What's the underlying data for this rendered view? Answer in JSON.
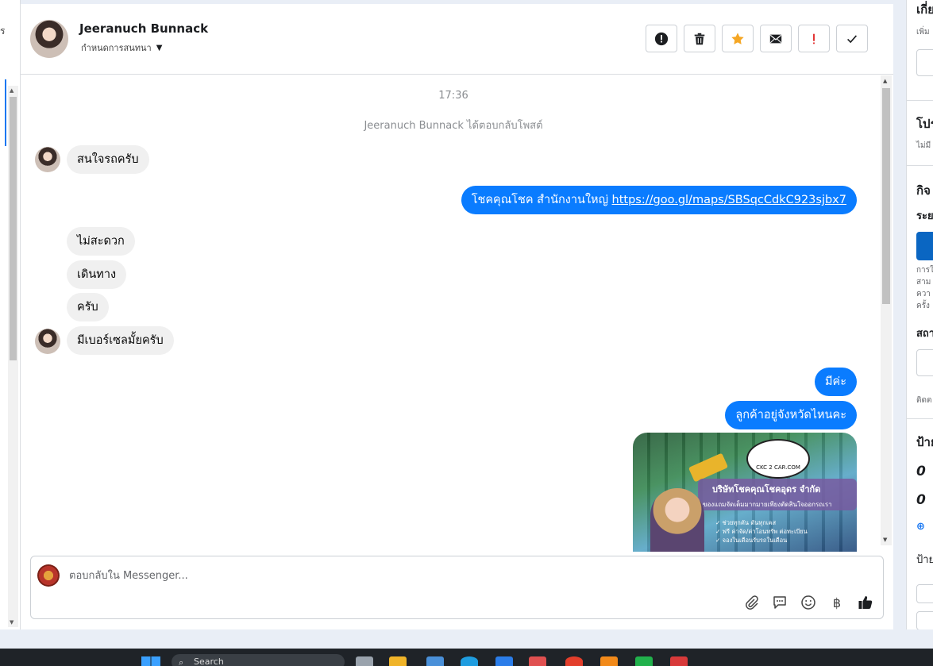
{
  "left_strip": {
    "cut_text": "ร"
  },
  "header": {
    "contact_name": "Jeeranuch Bunnack",
    "assign_label": "กำหนดการสนทนา",
    "actions": [
      {
        "name": "report-spam-button",
        "icon": "alert-circle-icon"
      },
      {
        "name": "delete-button",
        "icon": "trash-icon"
      },
      {
        "name": "star-button",
        "icon": "star-icon"
      },
      {
        "name": "mark-unread-button",
        "icon": "envelope-icon"
      },
      {
        "name": "mark-important-button",
        "icon": "exclamation-icon"
      },
      {
        "name": "mark-done-button",
        "icon": "check-icon"
      }
    ],
    "colors": {
      "star": "#f5a623",
      "important": "#e02020"
    }
  },
  "conversation": {
    "timestamp": "17:36",
    "reply_note": "Jeeranuch Bunnack ได้ตอบกลับโพสต์",
    "messages": [
      {
        "dir": "in",
        "text": "สนใจรถครับ"
      },
      {
        "dir": "out",
        "text_prefix": "โชคคุณโชค สำนักงานใหญ่ ",
        "link": "https://goo.gl/maps/SBSqcCdkC923sjbx7"
      },
      {
        "dir": "in",
        "text": "ไม่สะดวก"
      },
      {
        "dir": "in",
        "text": "เดินทาง"
      },
      {
        "dir": "in",
        "text": "ครับ"
      },
      {
        "dir": "in",
        "text": "มีเบอร์เซลมั้ยครับ"
      },
      {
        "dir": "out",
        "text": "มีค่ะ"
      },
      {
        "dir": "out",
        "text": "ลูกค้าอยู่จังหวัดไหนคะ"
      }
    ],
    "image_card": {
      "logo_text": "CKC 2 CAR.COM",
      "company": "บริษัทโชคคุณโชคอุดร จำกัด",
      "tagline": "ของแถมจัดเต็มมากมายเพียงตัดสินใจออกรถเรา",
      "perks": [
        "ช่วยทุกคัน ดันทุกเคส",
        "ฟรี ค่าจัด/ค่าโอนทรัพ ต่อทะเบียน",
        "จองในเดือนรับรถในเดือน"
      ]
    }
  },
  "composer": {
    "placeholder": "ตอบกลับใน Messenger...",
    "tools": [
      {
        "name": "attach-button",
        "icon": "paperclip-icon"
      },
      {
        "name": "saved-replies-button",
        "icon": "chat-bubble-icon"
      },
      {
        "name": "emoji-button",
        "icon": "smiley-icon"
      },
      {
        "name": "payment-button",
        "icon": "baht-icon",
        "glyph": "฿"
      },
      {
        "name": "like-button",
        "icon": "thumbs-up-icon"
      }
    ]
  },
  "right_panel": {
    "t1": "เกี่ย",
    "s1": "เพิ่ม",
    "t2": "โปร",
    "s2": "ไม่มี",
    "t3": "กิจ",
    "s3": "ระย",
    "s4": [
      "การใ",
      "สาม",
      "ควา",
      "ครั้ง"
    ],
    "t4": "สถา",
    "s5": "ติดต",
    "t5": "ป้าย",
    "v1": "0",
    "v2": "0",
    "s6": "ป้าย"
  },
  "taskbar": {
    "search_text": "Search"
  },
  "accent": "#0a7cff"
}
